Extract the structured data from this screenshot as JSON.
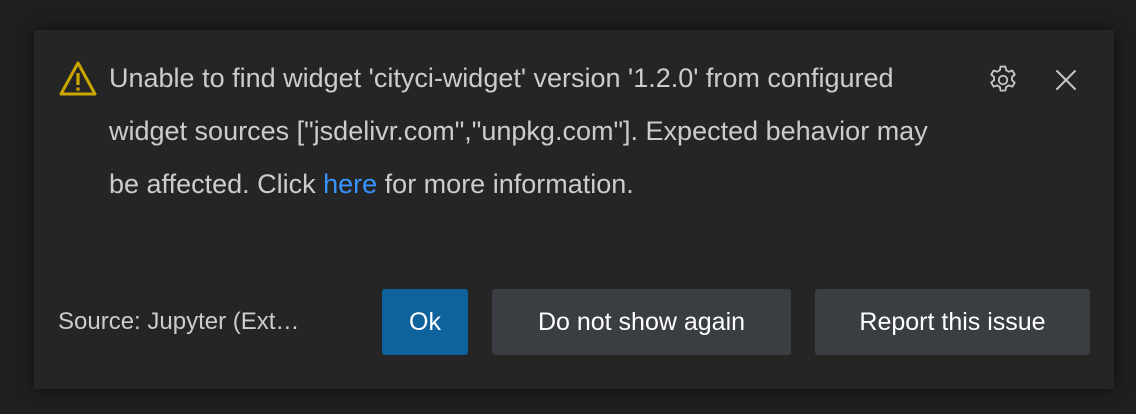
{
  "notification": {
    "message_pre": "Unable to find widget 'cityci-widget' version '1.2.0' from configured widget sources [\"jsdelivr.com\",\"unpkg.com\"]. Expected behavior may be affected. Click ",
    "link_text": "here",
    "message_post": " for more information.",
    "source": "Source: Jupyter (Ext…",
    "icons": {
      "severity": "warning-icon",
      "settings": "gear-icon",
      "close": "close-icon"
    },
    "buttons": {
      "ok": "Ok",
      "dont_show": "Do not show again",
      "report": "Report this issue"
    },
    "colors": {
      "warning": "#cca700",
      "link": "#3794ff",
      "primary_button": "#0e639c",
      "secondary_button": "#3a3d41"
    }
  }
}
